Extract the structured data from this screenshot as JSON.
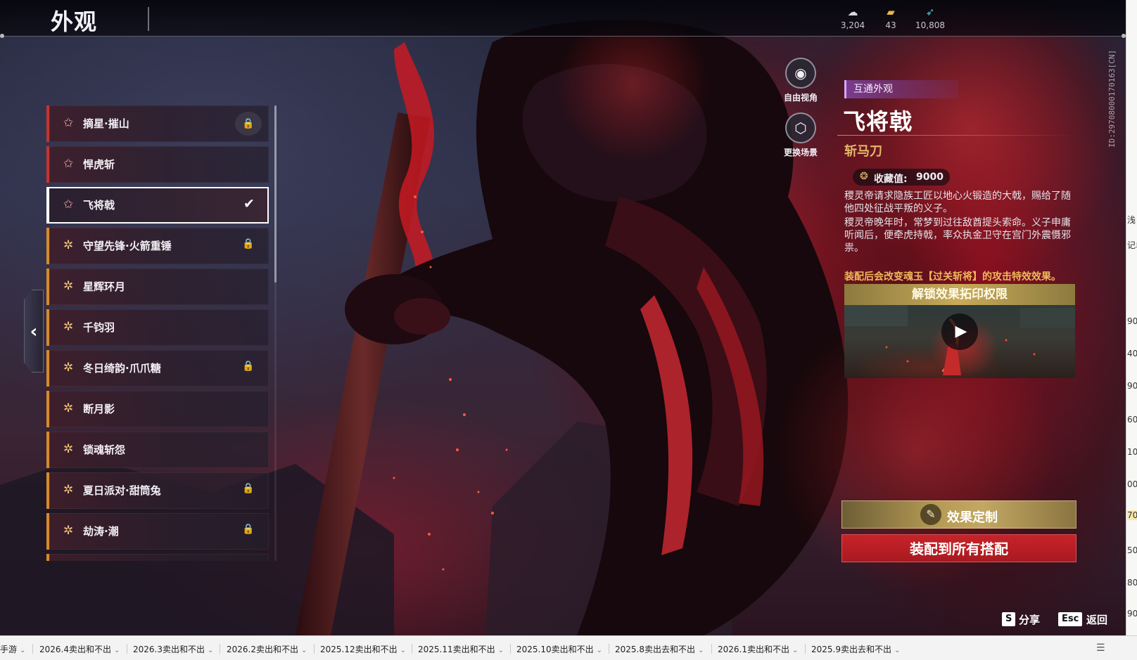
{
  "page": {
    "title": "外观"
  },
  "currencies": [
    {
      "icon": "cloud-coin-icon",
      "value": "3,204",
      "color": "#d8d8e0"
    },
    {
      "icon": "ticket-icon",
      "value": "43",
      "color": "#e8b64a"
    },
    {
      "icon": "feather-icon",
      "value": "10,808",
      "color": "#4fc6d6"
    }
  ],
  "list": {
    "items": [
      {
        "name": "摘星·摧山",
        "rarity": "red",
        "locked": true
      },
      {
        "name": "悍虎斩",
        "rarity": "red",
        "locked": false
      },
      {
        "name": "飞将戟",
        "rarity": "red",
        "locked": false,
        "selected": true
      },
      {
        "name": "守望先锋·火箭重锤",
        "rarity": "gold",
        "locked": true
      },
      {
        "name": "星辉环月",
        "rarity": "gold",
        "locked": false
      },
      {
        "name": "千钧羽",
        "rarity": "gold",
        "locked": false
      },
      {
        "name": "冬日绮韵·爪爪糖",
        "rarity": "gold",
        "locked": true
      },
      {
        "name": "断月影",
        "rarity": "gold",
        "locked": false
      },
      {
        "name": "锁魂斩怨",
        "rarity": "gold",
        "locked": false
      },
      {
        "name": "夏日派对·甜筒兔",
        "rarity": "gold",
        "locked": true
      },
      {
        "name": "劫涛·潮",
        "rarity": "gold",
        "locked": true
      }
    ]
  },
  "camera": {
    "free_view_label": "自由视角",
    "change_scene_label": "更换场景"
  },
  "detail": {
    "tag": "互通外观",
    "name": "飞将戟",
    "weapon_type": "斩马刀",
    "collect_label": "收藏值:",
    "collect_value": "9000",
    "desc1": "稷灵帝请求隐族工匠以地心火锻造的大戟，赐给了随他四处征战平叛的义子。",
    "desc2": "稷灵帝晚年时，常梦到过往敌酋提头索命。义子申庸听闻后，便牵虎持戟，率众执金卫守在宫门外震慑邪祟。",
    "effect_note": "装配后会改变魂玉【过关斩将】的攻击特效效果。",
    "unlock_title": "解锁效果拓印权限",
    "effect_button": "效果定制",
    "equip_button": "装配到所有搭配",
    "id_text": "ID:2970800017016З[CN]"
  },
  "hints": [
    {
      "key": "S",
      "label": "分享"
    },
    {
      "key": "Esc",
      "label": "返回"
    }
  ],
  "edge": {
    "cells": [
      "浅",
      "记单",
      "90",
      "40",
      "90",
      "60",
      "10",
      "00",
      "70",
      "50",
      "80",
      "90"
    ]
  },
  "sheet_tabs": [
    "手游",
    "2026.4卖出和不出",
    "2026.3卖出和不出",
    "2026.2卖出和不出",
    "2025.12卖出和不出",
    "2025.11卖出和不出",
    "2025.10卖出和不出",
    "2025.8卖出去和不出",
    "2026.1卖出和不出",
    "2025.9卖出去和不出"
  ]
}
